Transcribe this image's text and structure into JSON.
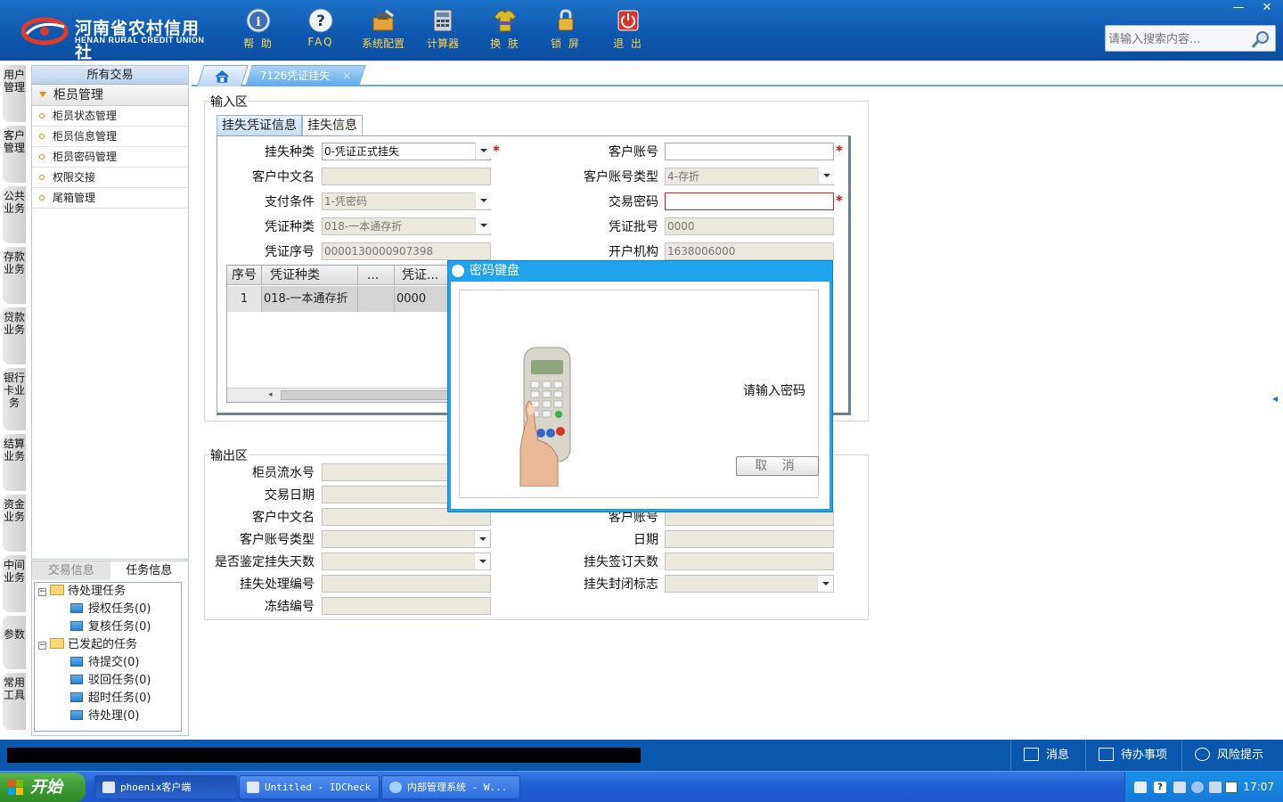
{
  "header": {
    "logo_cn": "河南省农村信用社",
    "logo_en": "HENAN RURAL CREDIT UNION",
    "toolbar": [
      {
        "label": "帮 助",
        "icon": "help-icon"
      },
      {
        "label": "FAQ",
        "icon": "faq-icon"
      },
      {
        "label": "系统配置",
        "icon": "toolbox-icon"
      },
      {
        "label": "计算器",
        "icon": "calculator-icon"
      },
      {
        "label": "换 肤",
        "icon": "shirt-icon"
      },
      {
        "label": "锁 屏",
        "icon": "lock-icon"
      },
      {
        "label": "退 出",
        "icon": "power-icon"
      }
    ],
    "search_placeholder": "请输入搜索内容...",
    "minimize": "—",
    "close": "✕"
  },
  "vnav": [
    "用户管理",
    "客户管理",
    "公共业务",
    "存款业务",
    "贷款业务",
    "银行卡业务",
    "结算业务",
    "资金业务",
    "中间业务",
    "参数",
    "常用工具"
  ],
  "sidebar": {
    "title": "所有交易",
    "group": "柜员管理",
    "items": [
      "柜员状态管理",
      "柜员信息管理",
      "柜员密码管理",
      "权限交接",
      "尾箱管理"
    ]
  },
  "taskpanel": {
    "tab_trade": "交易信息",
    "tab_task": "任务信息",
    "pending": "待处理任务",
    "auth": "授权任务(0)",
    "review": "复核任务(0)",
    "initiated": "已发起的任务",
    "submit": "待提交(0)",
    "rejected": "驳回任务(0)",
    "timeout": "超时任务(0)",
    "todo": "待处理(0)"
  },
  "tabs": {
    "home_icon": "home-icon",
    "active": "7126凭证挂失",
    "close": "×"
  },
  "input_area": {
    "title": "输入区",
    "subtabs": [
      "挂失凭证信息",
      "挂失信息"
    ],
    "fields": {
      "loss_type_label": "挂失种类",
      "loss_type": "0-凭证正式挂失",
      "customer_name_label": "客户中文名",
      "customer_name": "",
      "pay_cond_label": "支付条件",
      "pay_cond": "1-凭密码",
      "voucher_type_label": "凭证种类",
      "voucher_type": "018-一本通存折",
      "voucher_seq_label": "凭证序号",
      "voucher_seq": "0000130000907398",
      "account_label": "客户账号",
      "account": "",
      "account_type_label": "客户账号类型",
      "account_type": "4-存折",
      "password_label": "交易密码",
      "password": "",
      "batch_label": "凭证批号",
      "batch": "0000",
      "branch_label": "开户机构",
      "branch": "1638006000"
    },
    "grid": {
      "headers": [
        "序号",
        "凭证种类",
        "...",
        "凭证..."
      ],
      "row": [
        "1",
        "018-一本通存折",
        "",
        "0000"
      ]
    }
  },
  "output_area": {
    "title": "输出区",
    "left_labels": [
      "柜员流水号",
      "交易日期",
      "客户中文名",
      "客户账号类型",
      "是否鉴定挂失天数",
      "挂失处理编号",
      "冻结编号"
    ],
    "right_labels": [
      "客户账号",
      "日期",
      "挂失签订天数",
      "挂失封闭标志"
    ]
  },
  "modal": {
    "title": "密码键盘",
    "prompt": "请输入密码",
    "cancel": "取 消",
    "image": "pinpad-image"
  },
  "statusbar": {
    "messages": "消息",
    "todo": "待办事项",
    "risk": "风险提示"
  },
  "taskbar": {
    "start": "开始",
    "items": [
      "phoenix客户端",
      "Untitled - IDCheck",
      "内部管理系统 - W..."
    ],
    "clock": "17:07"
  },
  "colors": {
    "header": "#0d57ae",
    "modal": "#1fa3ef",
    "accent": "#e08a1e",
    "required": "#d01010"
  }
}
